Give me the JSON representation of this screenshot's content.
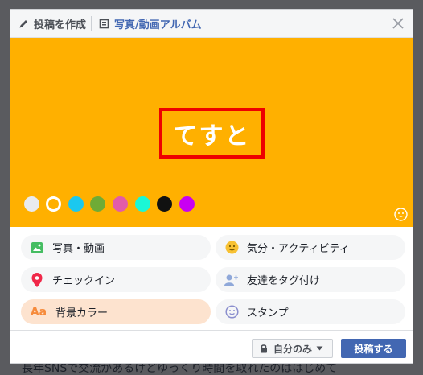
{
  "background_text": "長年SNSで交流があるけどゆっくり時間を取れたのははじめて",
  "header": {
    "tab_create_label": "投稿を作成",
    "tab_album_label": "写真/動画アルバム"
  },
  "composer": {
    "background_color": "#ffb000",
    "post_text": "てすと",
    "highlight_color": "#ee0000",
    "swatches": [
      {
        "color": "#e9ebee",
        "selected": false
      },
      {
        "color": "#ffb000",
        "selected": true
      },
      {
        "color": "#1bc8ef",
        "selected": false
      },
      {
        "color": "#6fab36",
        "selected": false
      },
      {
        "color": "#e25ca9",
        "selected": false
      },
      {
        "color": "#1bf7d6",
        "selected": false
      },
      {
        "color": "#111111",
        "selected": false
      },
      {
        "color": "#c800f2",
        "selected": false
      }
    ]
  },
  "options": {
    "photo_video": "写真・動画",
    "feeling_activity": "気分・アクティビティ",
    "checkin": "チェックイン",
    "tag_friends": "友達をタグ付け",
    "background_color": "背景カラー",
    "sticker": "スタンプ",
    "background_color_icon_text": "Aa"
  },
  "footer": {
    "privacy_label": "自分のみ",
    "submit_label": "投稿する"
  },
  "colors": {
    "accent_blue": "#4267b2",
    "active_option_bg": "#fde3cf"
  }
}
